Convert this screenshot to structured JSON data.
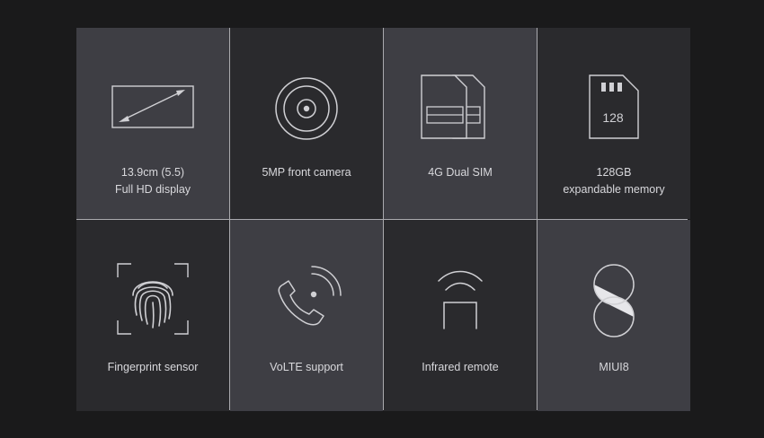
{
  "features": [
    {
      "icon": "display-diagonal-icon",
      "line1": "13.9cm (5.5)",
      "line2": "Full HD display"
    },
    {
      "icon": "camera-lens-icon",
      "line1": "5MP front camera",
      "line2": ""
    },
    {
      "icon": "dual-sim-icon",
      "line1": "4G Dual SIM",
      "line2": ""
    },
    {
      "icon": "sd-card-icon",
      "line1": "128GB",
      "line2": "expandable memory",
      "badge": "128"
    },
    {
      "icon": "fingerprint-icon",
      "line1": "Fingerprint sensor",
      "line2": ""
    },
    {
      "icon": "volte-phone-icon",
      "line1": "VoLTE support",
      "line2": ""
    },
    {
      "icon": "infrared-remote-icon",
      "line1": "Infrared remote",
      "line2": ""
    },
    {
      "icon": "miui-logo-icon",
      "line1": "MIUI8",
      "line2": ""
    }
  ],
  "colors": {
    "page_background": "#1a1a1b",
    "tile_light": "#3e3e44",
    "tile_dark": "#2a2a2d",
    "divider": "#aaaaae",
    "icon_stroke": "#d0d0d4",
    "text": "#d8d8dc"
  }
}
